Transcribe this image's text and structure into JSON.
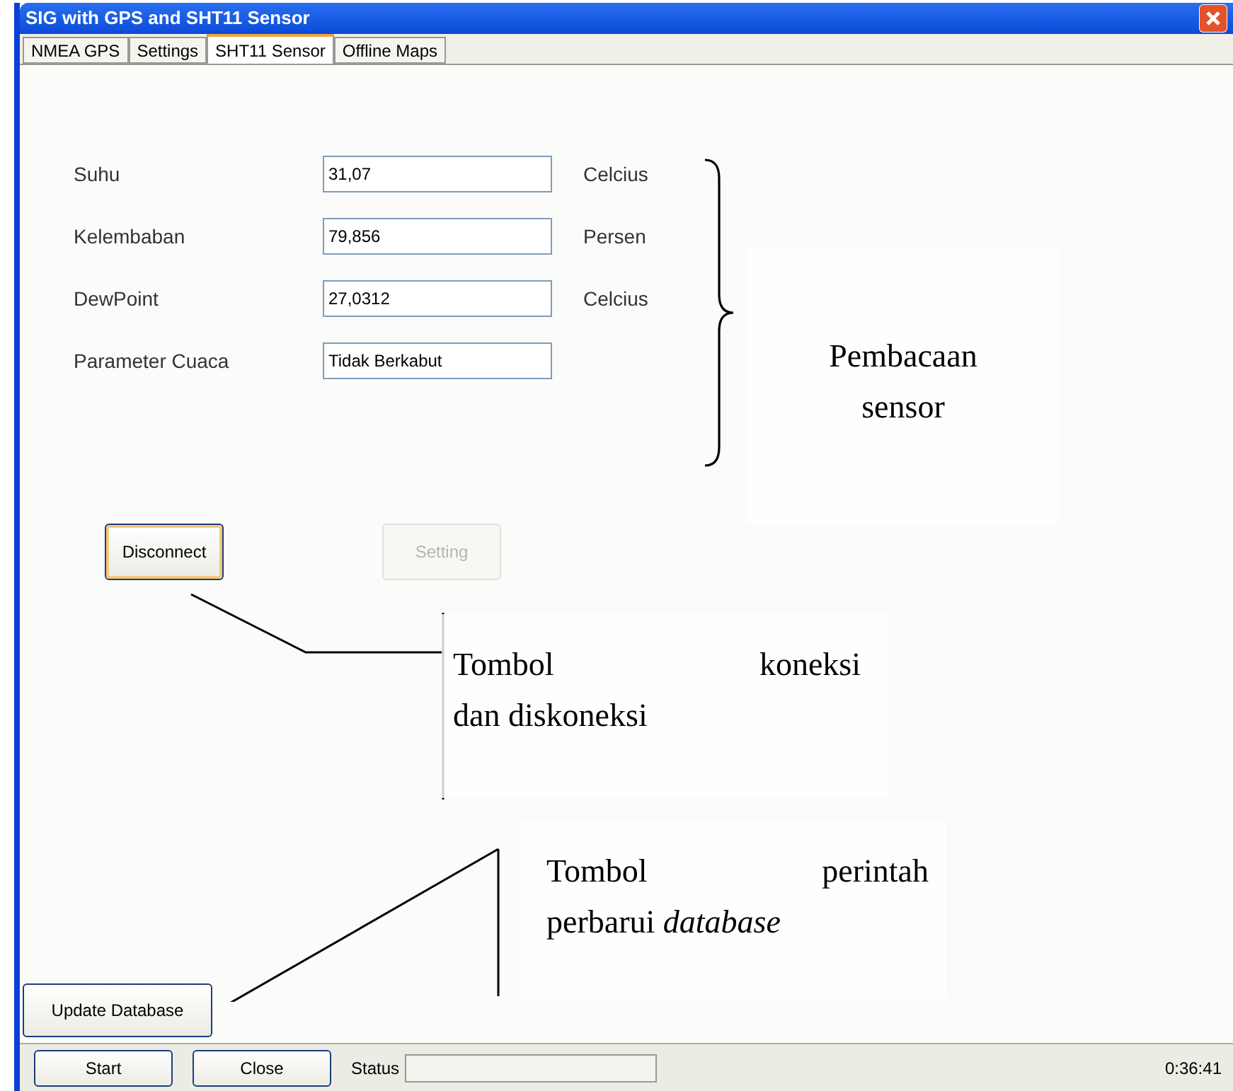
{
  "window": {
    "title": "SIG with GPS and SHT11 Sensor"
  },
  "tabs": [
    {
      "label": "NMEA GPS",
      "selected": false
    },
    {
      "label": "Settings",
      "selected": false
    },
    {
      "label": "SHT11 Sensor",
      "selected": true
    },
    {
      "label": "Offline Maps",
      "selected": false
    }
  ],
  "readings": [
    {
      "label": "Suhu",
      "value": "31,07",
      "unit": "Celcius"
    },
    {
      "label": "Kelembaban",
      "value": "79,856",
      "unit": "Persen"
    },
    {
      "label": "DewPoint",
      "value": "27,0312",
      "unit": "Celcius"
    },
    {
      "label": "Parameter Cuaca",
      "value": "Tidak Berkabut"
    }
  ],
  "controls": [
    {
      "label": "Disconnect",
      "disabled": false
    },
    {
      "label": "Setting",
      "disabled": true
    }
  ],
  "update_button": {
    "label": "Update Database"
  },
  "annotations": [
    {
      "kind": "brace",
      "lines": [
        "Pembacaan",
        "sensor"
      ]
    },
    {
      "kind": "callout",
      "lines": [
        "Tombol koneksi",
        "dan diskoneksi"
      ]
    },
    {
      "kind": "callout",
      "lines": [
        "Tombol perintah",
        "perbarui *database*"
      ]
    }
  ],
  "bottom_bar": {
    "buttons": [
      "Start",
      "Close"
    ],
    "status_label": "Status",
    "clock": "0:36:41"
  }
}
